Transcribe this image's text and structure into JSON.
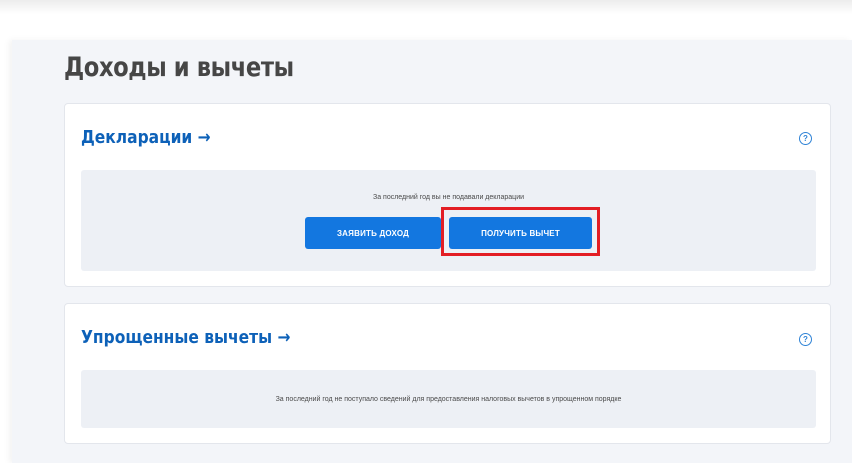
{
  "page": {
    "title": "Доходы и вычеты"
  },
  "declarations": {
    "title": "Декларации →",
    "help_icon": "?",
    "empty_text": "За последний год вы не подавали декларации",
    "declare_income_label": "ЗАЯВИТЬ ДОХОД",
    "get_deduction_label": "ПОЛУЧИТЬ ВЫЧЕТ"
  },
  "simplified_deductions": {
    "title": "Упрощенные вычеты →",
    "help_icon": "?",
    "empty_text": "За последний год не поступало сведений для предоставления налоговых вычетов в упрощенном порядке"
  },
  "colors": {
    "accent_blue": "#1377e0",
    "link_blue": "#0d61b8",
    "highlight_red": "#e31e24",
    "background": "#f3f5f9"
  },
  "icons": {
    "help": "question-circle-icon",
    "arrow": "arrow-right-icon"
  }
}
